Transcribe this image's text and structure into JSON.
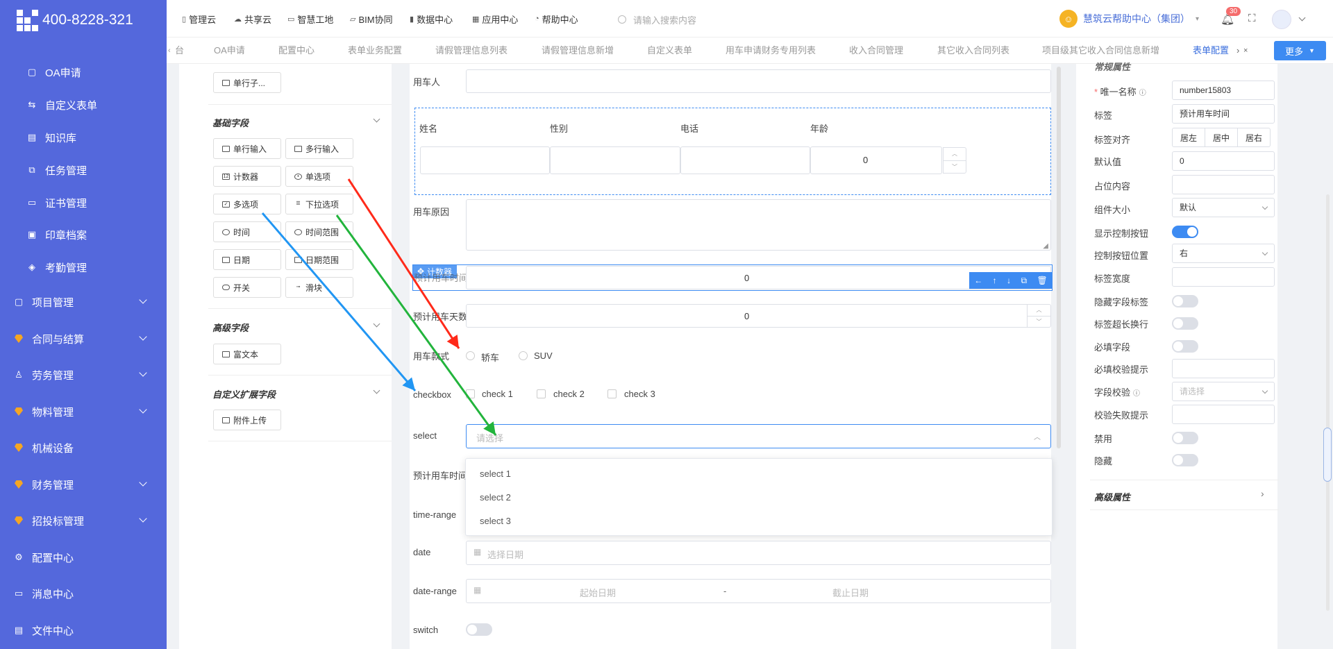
{
  "sidebar": {
    "phone": "400-8228-321",
    "items": [
      {
        "label": "OA申请",
        "icon": "document-icon"
      },
      {
        "label": "自定义表单",
        "icon": "swap-icon"
      },
      {
        "label": "知识库",
        "icon": "book-icon"
      },
      {
        "label": "任务管理",
        "icon": "hierarchy-icon"
      },
      {
        "label": "证书管理",
        "icon": "certificate-icon"
      },
      {
        "label": "印章档案",
        "icon": "stamp-icon"
      },
      {
        "label": "考勤管理",
        "icon": "tag-icon"
      },
      {
        "label": "项目管理",
        "icon": "project-icon"
      },
      {
        "label": "合同与结算",
        "icon": "gem-icon"
      },
      {
        "label": "劳务管理",
        "icon": "user-icon"
      },
      {
        "label": "物料管理",
        "icon": "gem-icon"
      },
      {
        "label": "机械设备",
        "icon": "gem-icon"
      },
      {
        "label": "财务管理",
        "icon": "gem-icon"
      },
      {
        "label": "招投标管理",
        "icon": "gem-icon"
      },
      {
        "label": "配置中心",
        "icon": "gear-icon"
      },
      {
        "label": "消息中心",
        "icon": "message-icon"
      },
      {
        "label": "文件中心",
        "icon": "file-icon"
      }
    ]
  },
  "topnav": {
    "items": [
      "管理云",
      "共享云",
      "智慧工地",
      "BIM协同",
      "数据中心",
      "应用中心",
      "帮助中心"
    ],
    "search_placeholder": "请输入搜索内容",
    "help_center": "慧筑云帮助中心（集团）",
    "badge": "30"
  },
  "tabs": {
    "items": [
      "OA申请",
      "配置中心",
      "表单业务配置",
      "请假管理信息列表",
      "请假管理信息新增",
      "自定义表单",
      "用车申请财务专用列表",
      "收入合同管理",
      "其它收入合同列表",
      "项目级其它收入合同信息新增",
      "表单配置"
    ],
    "active": "表单配置",
    "left_clip": "台",
    "more": "更多"
  },
  "palette": {
    "top_button": "单行子...",
    "basic_title": "基础字段",
    "basic": [
      "单行输入",
      "多行输入",
      "计数器",
      "单选项",
      "多选项",
      "下拉选项",
      "时间",
      "时间范围",
      "日期",
      "日期范围",
      "开关",
      "滑块"
    ],
    "advanced_title": "高级字段",
    "advanced": [
      "富文本"
    ],
    "custom_title": "自定义扩展字段",
    "custom": [
      "附件上传"
    ]
  },
  "form": {
    "car_user": "用车人",
    "sub_headers": [
      "姓名",
      "性别",
      "电话",
      "年龄"
    ],
    "age_value": "0",
    "reason": "用车原因",
    "counter_tag": "计数器",
    "est_time_label": "预计用车时间",
    "counter_value": "0",
    "est_days": "预计用车天数",
    "est_days_value": "0",
    "car_type": "用车款式",
    "radios": [
      "轿车",
      "SUV"
    ],
    "checkbox_label": "checkbox",
    "checks": [
      "check 1",
      "check 2",
      "check 3"
    ],
    "select_label": "select",
    "select_placeholder": "请选择",
    "options": [
      "select 1",
      "select 2",
      "select 3"
    ],
    "est_time2": "预计用车时间",
    "time_range": "time-range",
    "date_label": "date",
    "date_placeholder": "选择日期",
    "daterange_label": "date-range",
    "start_date": "起始日期",
    "dash": "-",
    "end_date": "截止日期",
    "switch_label": "switch"
  },
  "props": {
    "section_clip": "常规属性",
    "unique_name": "唯一名称",
    "unique_value": "number15803",
    "label": "标签",
    "label_value": "预计用车时间",
    "align": "标签对齐",
    "align_options": [
      "居左",
      "居中",
      "居右"
    ],
    "default": "默认值",
    "default_value": "0",
    "placeholder": "占位内容",
    "size": "组件大小",
    "size_value": "默认",
    "show_ctrl": "显示控制按钮",
    "ctrl_pos": "控制按钮位置",
    "ctrl_pos_value": "右",
    "label_width": "标签宽度",
    "hide_label": "隐藏字段标签",
    "label_wrap": "标签超长换行",
    "required": "必填字段",
    "required_msg": "必填校验提示",
    "validate": "字段校验",
    "validate_placeholder": "请选择",
    "validate_fail": "校验失败提示",
    "disabled": "禁用",
    "hidden": "隐藏",
    "advanced": "高级属性"
  },
  "colors": {
    "sidebar": "#5468dc",
    "accent": "#3d8bf2",
    "arrow_red": "#ff2a1a",
    "arrow_green": "#22b43c",
    "arrow_blue": "#2196f3"
  }
}
